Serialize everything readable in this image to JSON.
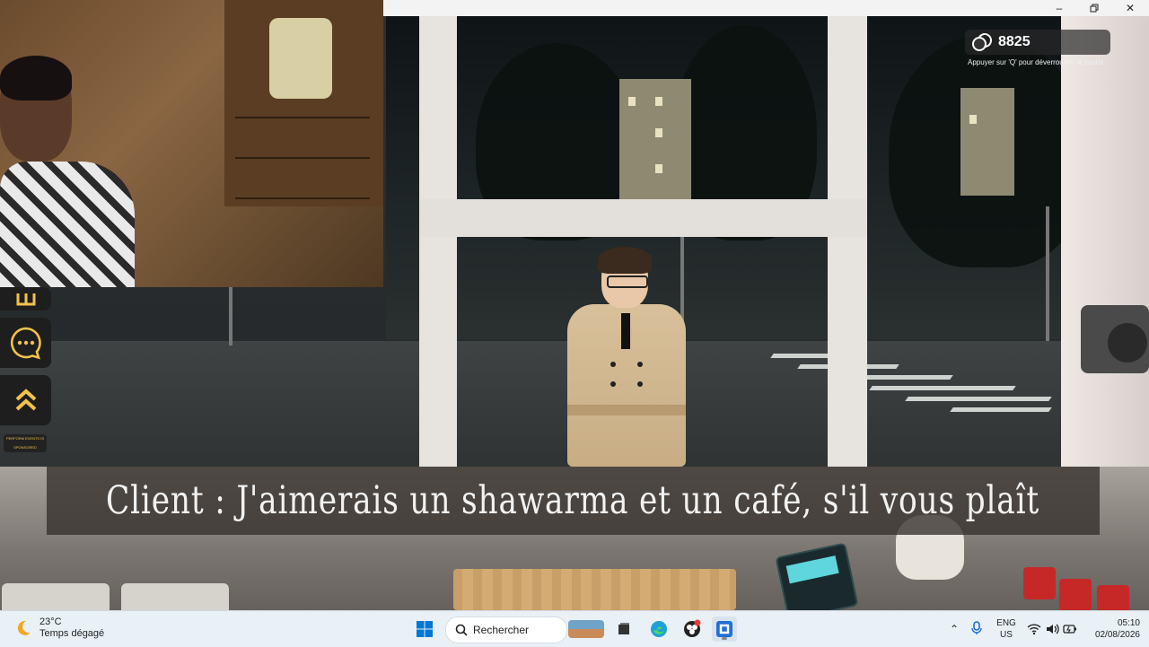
{
  "window": {
    "controls": [
      "minimize-icon",
      "restore-icon",
      "close-icon"
    ]
  },
  "hud": {
    "currency_value": "8825",
    "hint": "Appuyer sur 'Q' pour déverrouiller la souris"
  },
  "sidebar": {
    "buttons": [
      "chat-icon",
      "chevrons-up-icon"
    ],
    "small_label": "PERFORM EVENTS IS SPONSORED"
  },
  "subtitle": {
    "text": "Client : J'aimerais un shawarma et un café, s'il vous plaît"
  },
  "taskbar": {
    "weather_temp": "23°C",
    "weather_desc": "Temps dégagé",
    "search_placeholder": "Rechercher",
    "lang_top": "ENG",
    "lang_bottom": "US",
    "time": "05:10",
    "date": "02/08/2026"
  },
  "colors": {
    "accent_yellow": "#f1c24b",
    "taskbar_bg": "#e9f1f6",
    "windows_blue": "#0078d4"
  }
}
